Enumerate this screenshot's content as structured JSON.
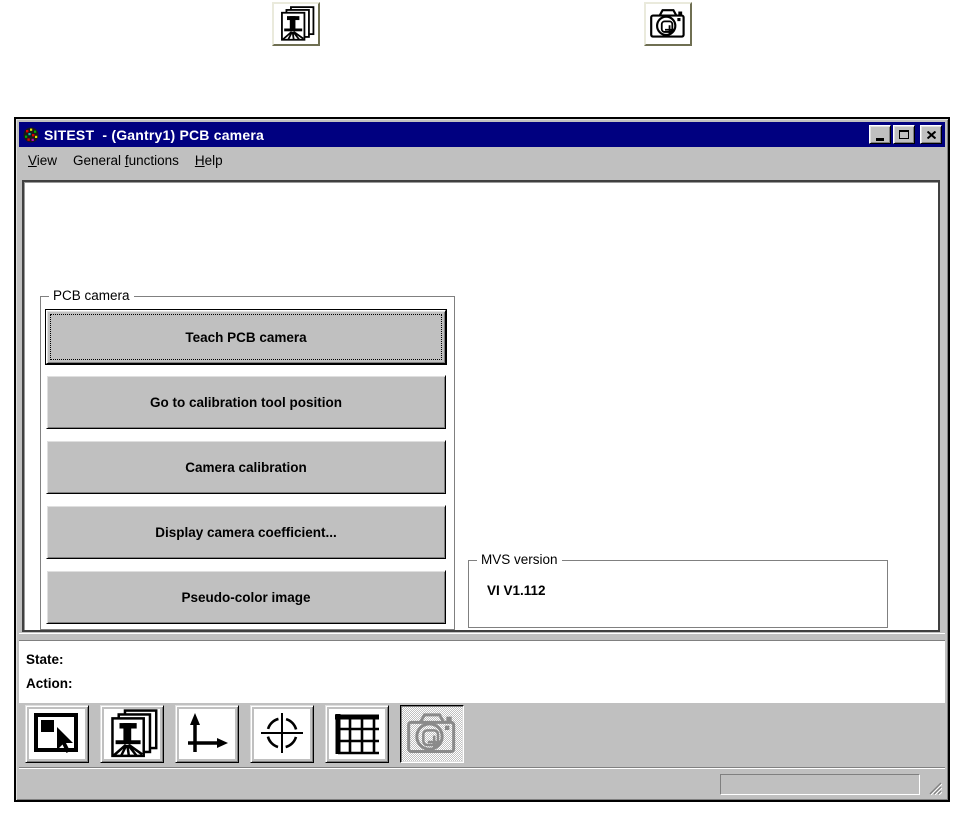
{
  "floating_toolbar": {
    "machine_button_icon": "pcb-machine-icon",
    "camera_button_icon": "pcb-camera-icon"
  },
  "window": {
    "title": "SITEST  - (Gantry1) PCB camera",
    "controls": [
      "minimize",
      "maximize",
      "close"
    ]
  },
  "menu": {
    "items": [
      {
        "label": "View",
        "pre": "",
        "key": "V",
        "post": "iew"
      },
      {
        "label": "General functions",
        "pre": "General ",
        "key": "f",
        "post": "unctions"
      },
      {
        "label": "Help",
        "pre": "",
        "key": "H",
        "post": "elp"
      }
    ]
  },
  "pcb_group": {
    "label": "PCB camera",
    "buttons": [
      "Teach PCB camera",
      "Go to calibration tool position",
      "Camera calibration",
      "Display camera coefficient...",
      "Pseudo-color image"
    ]
  },
  "mvs_group": {
    "label": "MVS version",
    "version": "VI V1.112"
  },
  "status_panel": {
    "state_label": "State:",
    "action_label": "Action:"
  },
  "toolbar": {
    "buttons": [
      {
        "icon": "select-cursor-icon",
        "pressed": false
      },
      {
        "icon": "pcb-machine-icon",
        "pressed": false
      },
      {
        "icon": "coordinate-axes-icon",
        "pressed": false
      },
      {
        "icon": "crosshair-target-icon",
        "pressed": false
      },
      {
        "icon": "grid-icon",
        "pressed": false
      },
      {
        "icon": "pcb-camera-icon",
        "pressed": true
      }
    ]
  },
  "colors": {
    "titlebar": "#000080",
    "window_gray": "#c0c0c0",
    "client_bg": "#ffffff",
    "title_text": "#ffffff"
  }
}
